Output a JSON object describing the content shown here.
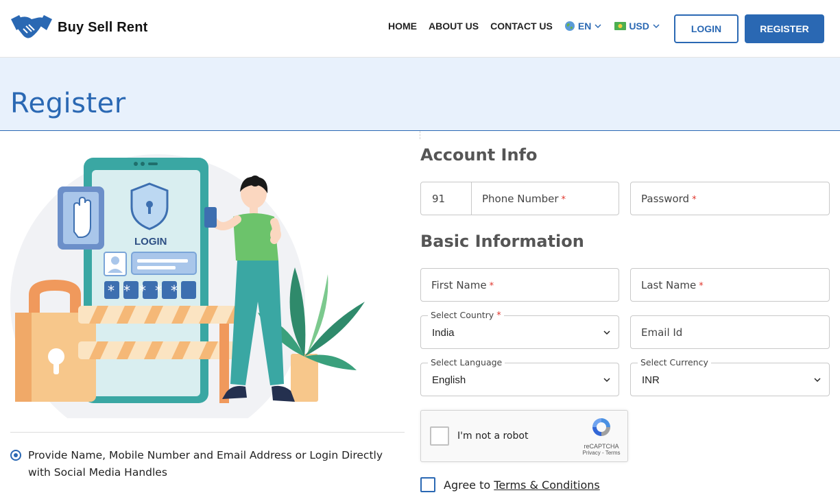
{
  "header": {
    "brand": "Buy Sell Rent",
    "nav": [
      "HOME",
      "ABOUT US",
      "CONTACT US"
    ],
    "language": "EN",
    "currency": "USD",
    "login_label": "LOGIN",
    "register_label": "REGISTER"
  },
  "banner": {
    "title": "Register"
  },
  "illustration": {
    "screen_label": "LOGIN",
    "password_mask": "*****"
  },
  "left_info": {
    "bullet_text": "Provide Name, Mobile Number and Email Address or Login Directly with Social Media Handles"
  },
  "form": {
    "account_title": "Account Info",
    "country_code": "91",
    "phone_placeholder": "Phone Number",
    "password_placeholder": "Password",
    "basic_title": "Basic Information",
    "first_name_placeholder": "First Name",
    "last_name_placeholder": "Last Name",
    "country_label": "Select Country",
    "country_value": "India",
    "email_placeholder": "Email Id",
    "language_label": "Select Language",
    "language_value": "English",
    "currency_label": "Select Currency",
    "currency_value": "INR",
    "required_mark": "*"
  },
  "captcha": {
    "text": "I'm not a robot",
    "brand": "reCAPTCHA",
    "links": "Privacy - Terms"
  },
  "agree": {
    "prefix": "Agree to",
    "link_text": "Terms & Conditions"
  },
  "colors": {
    "primary": "#2a68b3",
    "banner_bg": "#e8f1fc",
    "required": "#e0362d"
  }
}
